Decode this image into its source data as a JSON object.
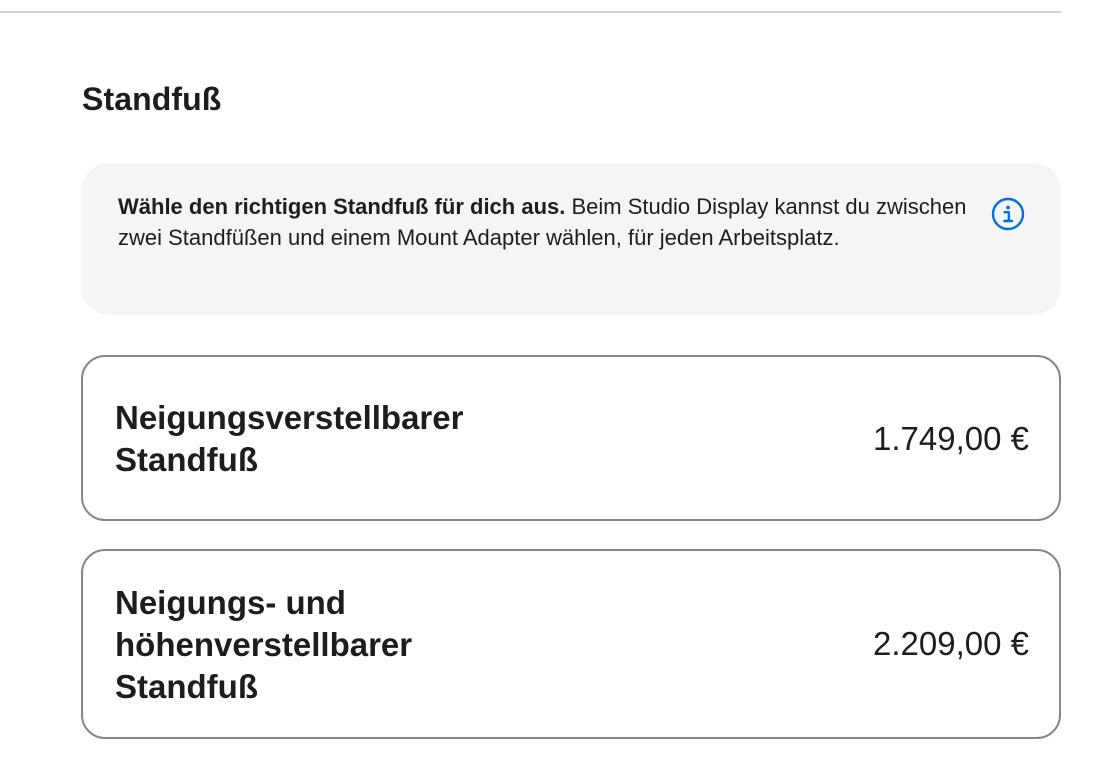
{
  "section": {
    "title": "Standfuß"
  },
  "info_box": {
    "bold_text": "Wähle den richtigen Standfuß für dich aus.",
    "body_text": " Beim Studio Display kannst du zwischen zwei Standfüßen und einem Mount Adapter wählen, für jeden Arbeitsplatz.",
    "icon": "info-circle-icon",
    "icon_color": "#0071e3"
  },
  "options": [
    {
      "name": "Neigungsverstellbarer Standfuß",
      "price": "1.749,00 €"
    },
    {
      "name": "Neigungs- und höhenverstellbarer Standfuß",
      "price": "2.209,00 €"
    }
  ],
  "colors": {
    "text": "#1d1d1f",
    "info_box_bg": "#f5f5f7",
    "option_border": "#86868b",
    "divider": "#d2d2d7"
  }
}
